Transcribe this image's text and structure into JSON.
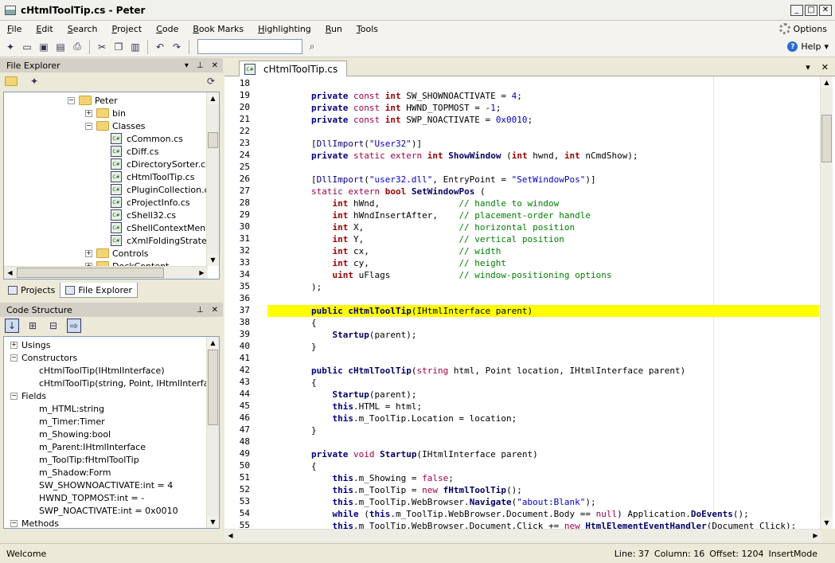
{
  "window": {
    "title": "cHtmlToolTip.cs - Peter"
  },
  "menu": [
    "File",
    "Edit",
    "Search",
    "Project",
    "Code",
    "Book Marks",
    "Highlighting",
    "Run",
    "Tools"
  ],
  "options_label": "Options",
  "help_label": "Help",
  "file_explorer": {
    "title": "File Explorer",
    "items": [
      {
        "label": "Peter",
        "type": "folder",
        "indent": 0,
        "expanded": true
      },
      {
        "label": "bin",
        "type": "folder",
        "indent": 1,
        "expanded": false
      },
      {
        "label": "Classes",
        "type": "folder",
        "indent": 1,
        "expanded": true
      },
      {
        "label": "cCommon.cs",
        "type": "file",
        "indent": 2
      },
      {
        "label": "cDiff.cs",
        "type": "file",
        "indent": 2
      },
      {
        "label": "cDirectorySorter.cs",
        "type": "file",
        "indent": 2
      },
      {
        "label": "cHtmlToolTip.cs",
        "type": "file",
        "indent": 2
      },
      {
        "label": "cPluginCollection.cs",
        "type": "file",
        "indent": 2
      },
      {
        "label": "cProjectInfo.cs",
        "type": "file",
        "indent": 2
      },
      {
        "label": "cShell32.cs",
        "type": "file",
        "indent": 2
      },
      {
        "label": "cShellContextMenu.cs",
        "type": "file",
        "indent": 2
      },
      {
        "label": "cXmlFoldingStrategy",
        "type": "file",
        "indent": 2
      },
      {
        "label": "Controls",
        "type": "folder",
        "indent": 1,
        "expanded": false
      },
      {
        "label": "DockContent",
        "type": "folder",
        "indent": 1,
        "expanded": false
      }
    ]
  },
  "panel_tabs": [
    {
      "label": "Projects"
    },
    {
      "label": "File Explorer"
    }
  ],
  "code_structure": {
    "title": "Code Structure",
    "items": [
      {
        "label": "Usings",
        "group": true,
        "expanded": false
      },
      {
        "label": "Constructors",
        "group": true,
        "expanded": true
      },
      {
        "label": "cHtmlToolTip(IHtmlInterface)",
        "group": false
      },
      {
        "label": "cHtmlToolTip(string, Point, IHtmlInterface)",
        "group": false
      },
      {
        "label": "Fields",
        "group": true,
        "expanded": true
      },
      {
        "label": "m_HTML:string",
        "group": false
      },
      {
        "label": "m_Timer:Timer",
        "group": false
      },
      {
        "label": "m_Showing:bool",
        "group": false
      },
      {
        "label": "m_Parent:IHtmlInterface",
        "group": false
      },
      {
        "label": "m_ToolTip:fHtmlToolTip",
        "group": false
      },
      {
        "label": "m_Shadow:Form",
        "group": false
      },
      {
        "label": "SW_SHOWNOACTIVATE:int = 4",
        "group": false
      },
      {
        "label": "HWND_TOPMOST:int = -",
        "group": false
      },
      {
        "label": "SWP_NOACTIVATE:int = 0x0010",
        "group": false
      },
      {
        "label": "Methods",
        "group": true,
        "expanded": true
      }
    ]
  },
  "document_tab": {
    "label": "cHtmlToolTip.cs"
  },
  "editor": {
    "first_line": 18,
    "highlight_line": 37,
    "lines": [
      "",
      "        <span class='k'>private</span> <span class='m'>const</span> <span class='t'>int</span> SW_SHOWNOACTIVATE = <span class='s'>4</span>;",
      "        <span class='k'>private</span> <span class='m'>const</span> <span class='t'>int</span> HWND_TOPMOST = -<span class='s'>1</span>;",
      "        <span class='k'>private</span> <span class='m'>const</span> <span class='t'>int</span> SWP_NOACTIVATE = <span class='s'>0x0010</span>;",
      "",
      "        [<span class='nm'>DllImport</span>(<span class='s'>\"User32\"</span>)]",
      "        <span class='k'>private</span> <span class='m'>static</span> <span class='m'>extern</span> <span class='t'>int</span> <span class='mt'>ShowWindow</span> (<span class='t'>int</span> hwnd, <span class='t'>int</span> nCmdShow);",
      "",
      "        [<span class='nm'>DllImport</span>(<span class='s'>\"user32.dll\"</span>, EntryPoint = <span class='s'>\"SetWindowPos\"</span>)]",
      "        <span class='m'>static</span> <span class='m'>extern</span> <span class='t'>bool</span> <span class='mt'>SetWindowPos</span> (",
      "            <span class='t'>int</span> hWnd,               <span class='c'>// handle to window</span>",
      "            <span class='t'>int</span> hWndInsertAfter,    <span class='c'>// placement-order handle</span>",
      "            <span class='t'>int</span> X,                  <span class='c'>// horizontal position</span>",
      "            <span class='t'>int</span> Y,                  <span class='c'>// vertical position</span>",
      "            <span class='t'>int</span> cx,                 <span class='c'>// width</span>",
      "            <span class='t'>int</span> cy,                 <span class='c'>// height</span>",
      "            <span class='t'>uint</span> uFlags             <span class='c'>// window-positioning options</span>",
      "        );",
      "",
      "        <span class='k'>public</span> <span class='mt'>cHtmlToolTip</span>(IHtmlInterface parent)",
      "        {",
      "            <span class='mt'>Startup</span>(parent);",
      "        }",
      "",
      "        <span class='k'>public</span> <span class='mt'>cHtmlToolTip</span>(<span class='m'>string</span> html, Point location, IHtmlInterface parent)",
      "        {",
      "            <span class='mt'>Startup</span>(parent);",
      "            <span class='k'>this</span>.HTML = html;",
      "            <span class='k'>this</span>.m_ToolTip.Location = location;",
      "        }",
      "",
      "        <span class='k'>private</span> <span class='m'>void</span> <span class='mt'>Startup</span>(IHtmlInterface parent)",
      "        {",
      "            <span class='k'>this</span>.m_Showing = <span class='m'>false</span>;",
      "            <span class='k'>this</span>.m_ToolTip = <span class='m'>new</span> <span class='mt'>fHtmlToolTip</span>();",
      "            <span class='k'>this</span>.m_ToolTip.WebBrowser.<span class='mt'>Navigate</span>(<span class='s'>\"about:Blank\"</span>);",
      "            <span class='k'>while</span> (<span class='k'>this</span>.m_ToolTip.WebBrowser.Document.Body == <span class='m'>null</span>) Application.<span class='mt'>DoEvents</span>();",
      "            <span class='k'>this</span>.m_ToolTip.WebBrowser.Document.Click += <span class='m'>new</span> <span class='mt'>HtmlElementEventHandler</span>(Document_Click);"
    ]
  },
  "status": {
    "message": "Welcome",
    "line": "Line: 37",
    "column": "Column: 16",
    "offset": "Offset: 1204",
    "mode": "InsertMode"
  }
}
